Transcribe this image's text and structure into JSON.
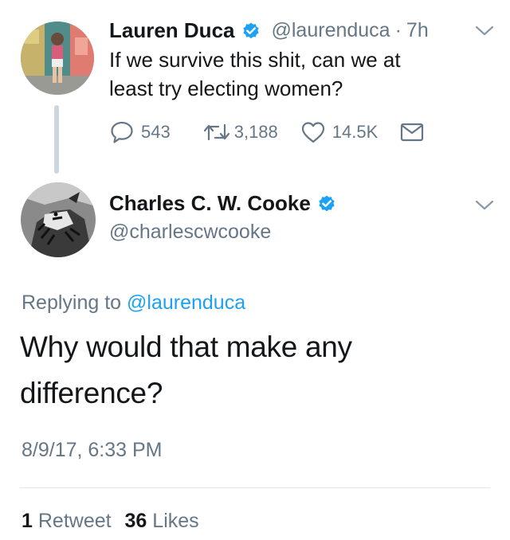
{
  "parent_tweet": {
    "display_name": "Lauren Duca",
    "handle": "@laurenduca",
    "separator": "·",
    "time": "7h",
    "text_line1": "If we survive this shit, can we at",
    "text_line2": "least try electing women?",
    "replies": "543",
    "retweets": "3,188",
    "likes": "14.5K",
    "icons": [
      "reply-icon",
      "retweet-icon",
      "like-icon",
      "message-icon",
      "verified-icon",
      "chevron-down-icon"
    ]
  },
  "main_tweet": {
    "display_name": "Charles C. W. Cooke",
    "handle": "@charlescwcooke",
    "replying_prefix": "Replying to",
    "replying_to": "@laurenduca",
    "text_line1": "Why would that make any",
    "text_line2": "difference?",
    "timestamp": "8/9/17, 6:33 PM",
    "retweet_count": "1",
    "retweet_label": "Retweet",
    "like_count": "36",
    "like_label": "Likes"
  },
  "colors": {
    "link": "#1da1f2",
    "secondary_text": "#657786",
    "primary_text": "#14171a",
    "thread_line": "#ccd6dd",
    "verified": "#1da1f2"
  }
}
